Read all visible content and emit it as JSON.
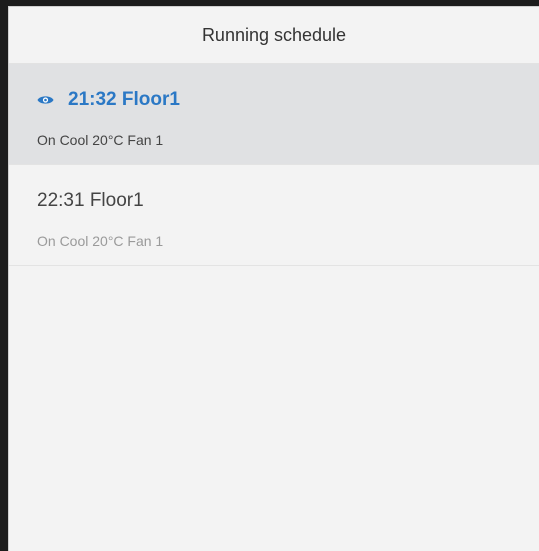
{
  "header": {
    "title": "Running schedule"
  },
  "schedule": {
    "items": [
      {
        "time_floor": "21:32 Floor1",
        "details": "On Cool 20°C Fan 1",
        "active": true,
        "indicator_icon": "eye-icon"
      },
      {
        "time_floor": "22:31 Floor1",
        "details": "On Cool 20°C Fan 1",
        "active": false
      }
    ]
  },
  "colors": {
    "accent": "#2b78c5",
    "active_bg": "#e0e1e3",
    "panel_bg": "#f3f3f3",
    "frame": "#1c1c1c"
  }
}
